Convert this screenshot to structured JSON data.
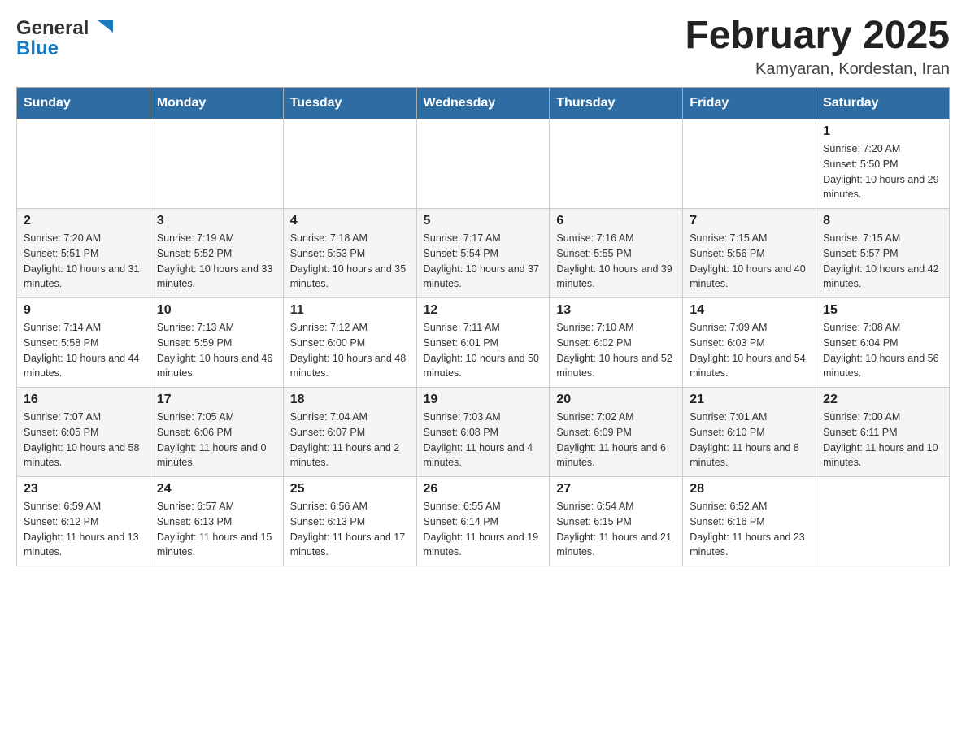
{
  "header": {
    "logo_general": "General",
    "logo_blue": "Blue",
    "month_title": "February 2025",
    "location": "Kamyaran, Kordestan, Iran"
  },
  "days_of_week": [
    "Sunday",
    "Monday",
    "Tuesday",
    "Wednesday",
    "Thursday",
    "Friday",
    "Saturday"
  ],
  "weeks": [
    [
      {
        "day": "",
        "sunrise": "",
        "sunset": "",
        "daylight": ""
      },
      {
        "day": "",
        "sunrise": "",
        "sunset": "",
        "daylight": ""
      },
      {
        "day": "",
        "sunrise": "",
        "sunset": "",
        "daylight": ""
      },
      {
        "day": "",
        "sunrise": "",
        "sunset": "",
        "daylight": ""
      },
      {
        "day": "",
        "sunrise": "",
        "sunset": "",
        "daylight": ""
      },
      {
        "day": "",
        "sunrise": "",
        "sunset": "",
        "daylight": ""
      },
      {
        "day": "1",
        "sunrise": "Sunrise: 7:20 AM",
        "sunset": "Sunset: 5:50 PM",
        "daylight": "Daylight: 10 hours and 29 minutes."
      }
    ],
    [
      {
        "day": "2",
        "sunrise": "Sunrise: 7:20 AM",
        "sunset": "Sunset: 5:51 PM",
        "daylight": "Daylight: 10 hours and 31 minutes."
      },
      {
        "day": "3",
        "sunrise": "Sunrise: 7:19 AM",
        "sunset": "Sunset: 5:52 PM",
        "daylight": "Daylight: 10 hours and 33 minutes."
      },
      {
        "day": "4",
        "sunrise": "Sunrise: 7:18 AM",
        "sunset": "Sunset: 5:53 PM",
        "daylight": "Daylight: 10 hours and 35 minutes."
      },
      {
        "day": "5",
        "sunrise": "Sunrise: 7:17 AM",
        "sunset": "Sunset: 5:54 PM",
        "daylight": "Daylight: 10 hours and 37 minutes."
      },
      {
        "day": "6",
        "sunrise": "Sunrise: 7:16 AM",
        "sunset": "Sunset: 5:55 PM",
        "daylight": "Daylight: 10 hours and 39 minutes."
      },
      {
        "day": "7",
        "sunrise": "Sunrise: 7:15 AM",
        "sunset": "Sunset: 5:56 PM",
        "daylight": "Daylight: 10 hours and 40 minutes."
      },
      {
        "day": "8",
        "sunrise": "Sunrise: 7:15 AM",
        "sunset": "Sunset: 5:57 PM",
        "daylight": "Daylight: 10 hours and 42 minutes."
      }
    ],
    [
      {
        "day": "9",
        "sunrise": "Sunrise: 7:14 AM",
        "sunset": "Sunset: 5:58 PM",
        "daylight": "Daylight: 10 hours and 44 minutes."
      },
      {
        "day": "10",
        "sunrise": "Sunrise: 7:13 AM",
        "sunset": "Sunset: 5:59 PM",
        "daylight": "Daylight: 10 hours and 46 minutes."
      },
      {
        "day": "11",
        "sunrise": "Sunrise: 7:12 AM",
        "sunset": "Sunset: 6:00 PM",
        "daylight": "Daylight: 10 hours and 48 minutes."
      },
      {
        "day": "12",
        "sunrise": "Sunrise: 7:11 AM",
        "sunset": "Sunset: 6:01 PM",
        "daylight": "Daylight: 10 hours and 50 minutes."
      },
      {
        "day": "13",
        "sunrise": "Sunrise: 7:10 AM",
        "sunset": "Sunset: 6:02 PM",
        "daylight": "Daylight: 10 hours and 52 minutes."
      },
      {
        "day": "14",
        "sunrise": "Sunrise: 7:09 AM",
        "sunset": "Sunset: 6:03 PM",
        "daylight": "Daylight: 10 hours and 54 minutes."
      },
      {
        "day": "15",
        "sunrise": "Sunrise: 7:08 AM",
        "sunset": "Sunset: 6:04 PM",
        "daylight": "Daylight: 10 hours and 56 minutes."
      }
    ],
    [
      {
        "day": "16",
        "sunrise": "Sunrise: 7:07 AM",
        "sunset": "Sunset: 6:05 PM",
        "daylight": "Daylight: 10 hours and 58 minutes."
      },
      {
        "day": "17",
        "sunrise": "Sunrise: 7:05 AM",
        "sunset": "Sunset: 6:06 PM",
        "daylight": "Daylight: 11 hours and 0 minutes."
      },
      {
        "day": "18",
        "sunrise": "Sunrise: 7:04 AM",
        "sunset": "Sunset: 6:07 PM",
        "daylight": "Daylight: 11 hours and 2 minutes."
      },
      {
        "day": "19",
        "sunrise": "Sunrise: 7:03 AM",
        "sunset": "Sunset: 6:08 PM",
        "daylight": "Daylight: 11 hours and 4 minutes."
      },
      {
        "day": "20",
        "sunrise": "Sunrise: 7:02 AM",
        "sunset": "Sunset: 6:09 PM",
        "daylight": "Daylight: 11 hours and 6 minutes."
      },
      {
        "day": "21",
        "sunrise": "Sunrise: 7:01 AM",
        "sunset": "Sunset: 6:10 PM",
        "daylight": "Daylight: 11 hours and 8 minutes."
      },
      {
        "day": "22",
        "sunrise": "Sunrise: 7:00 AM",
        "sunset": "Sunset: 6:11 PM",
        "daylight": "Daylight: 11 hours and 10 minutes."
      }
    ],
    [
      {
        "day": "23",
        "sunrise": "Sunrise: 6:59 AM",
        "sunset": "Sunset: 6:12 PM",
        "daylight": "Daylight: 11 hours and 13 minutes."
      },
      {
        "day": "24",
        "sunrise": "Sunrise: 6:57 AM",
        "sunset": "Sunset: 6:13 PM",
        "daylight": "Daylight: 11 hours and 15 minutes."
      },
      {
        "day": "25",
        "sunrise": "Sunrise: 6:56 AM",
        "sunset": "Sunset: 6:13 PM",
        "daylight": "Daylight: 11 hours and 17 minutes."
      },
      {
        "day": "26",
        "sunrise": "Sunrise: 6:55 AM",
        "sunset": "Sunset: 6:14 PM",
        "daylight": "Daylight: 11 hours and 19 minutes."
      },
      {
        "day": "27",
        "sunrise": "Sunrise: 6:54 AM",
        "sunset": "Sunset: 6:15 PM",
        "daylight": "Daylight: 11 hours and 21 minutes."
      },
      {
        "day": "28",
        "sunrise": "Sunrise: 6:52 AM",
        "sunset": "Sunset: 6:16 PM",
        "daylight": "Daylight: 11 hours and 23 minutes."
      },
      {
        "day": "",
        "sunrise": "",
        "sunset": "",
        "daylight": ""
      }
    ]
  ]
}
